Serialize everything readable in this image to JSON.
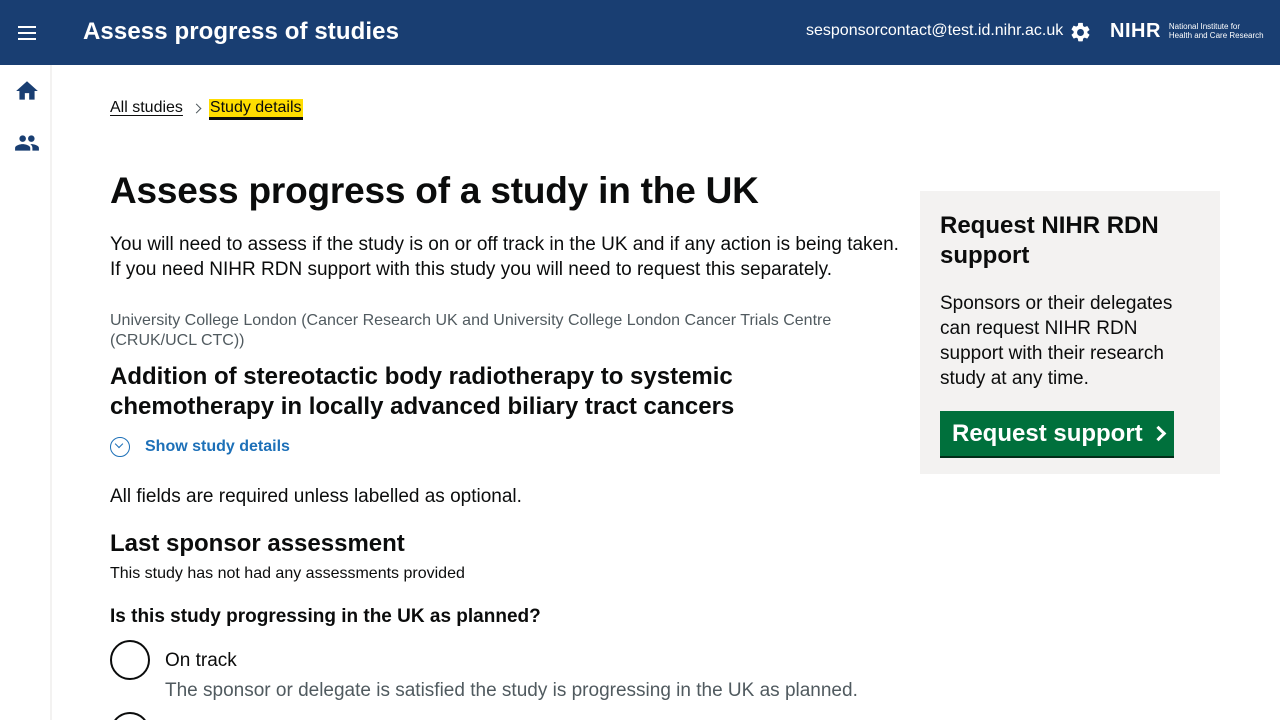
{
  "header": {
    "title": "Assess progress of studies",
    "user_email": "sesponsorcontact@test.id.nihr.ac.uk",
    "logo_main": "NIHR",
    "logo_sub_line1": "National Institute for",
    "logo_sub_line2": "Health and Care Research",
    "background_color": "#193e72"
  },
  "rail": {
    "items": [
      {
        "icon": "home-icon"
      },
      {
        "icon": "people-icon"
      }
    ]
  },
  "breadcrumb": {
    "items": [
      {
        "label": "All studies"
      },
      {
        "label": "Study details"
      }
    ]
  },
  "main": {
    "title": "Assess progress of a study in the UK",
    "intro": "You will need to assess if the study is on or off track in the UK and if any action is being taken. If you need NIHR RDN support with this study you will need to request this separately.",
    "organisation": "University College London (Cancer Research UK and University College London Cancer Trials Centre (CRUK/UCL CTC))",
    "study_title": "Addition of stereotactic body radiotherapy to systemic chemotherapy in locally advanced biliary tract cancers",
    "show_details_label": "Show study details",
    "required_note": "All fields are required unless labelled as optional.",
    "last_assessment_heading": "Last sponsor assessment",
    "last_assessment_text": "This study has not had any assessments provided",
    "question": "Is this study progressing in the UK as planned?",
    "options": [
      {
        "label": "On track",
        "hint": "The sponsor or delegate is satisfied the study is progressing in the UK as planned."
      }
    ]
  },
  "panel": {
    "title": "Request NIHR RDN support",
    "body": "Sponsors or their delegates can request NIHR RDN support with their research study at any time.",
    "button_label": "Request support",
    "button_color": "#00703c"
  },
  "colors": {
    "link": "#1d70b8",
    "focus": "#ffdd00",
    "secondary_text": "#505a5f"
  }
}
